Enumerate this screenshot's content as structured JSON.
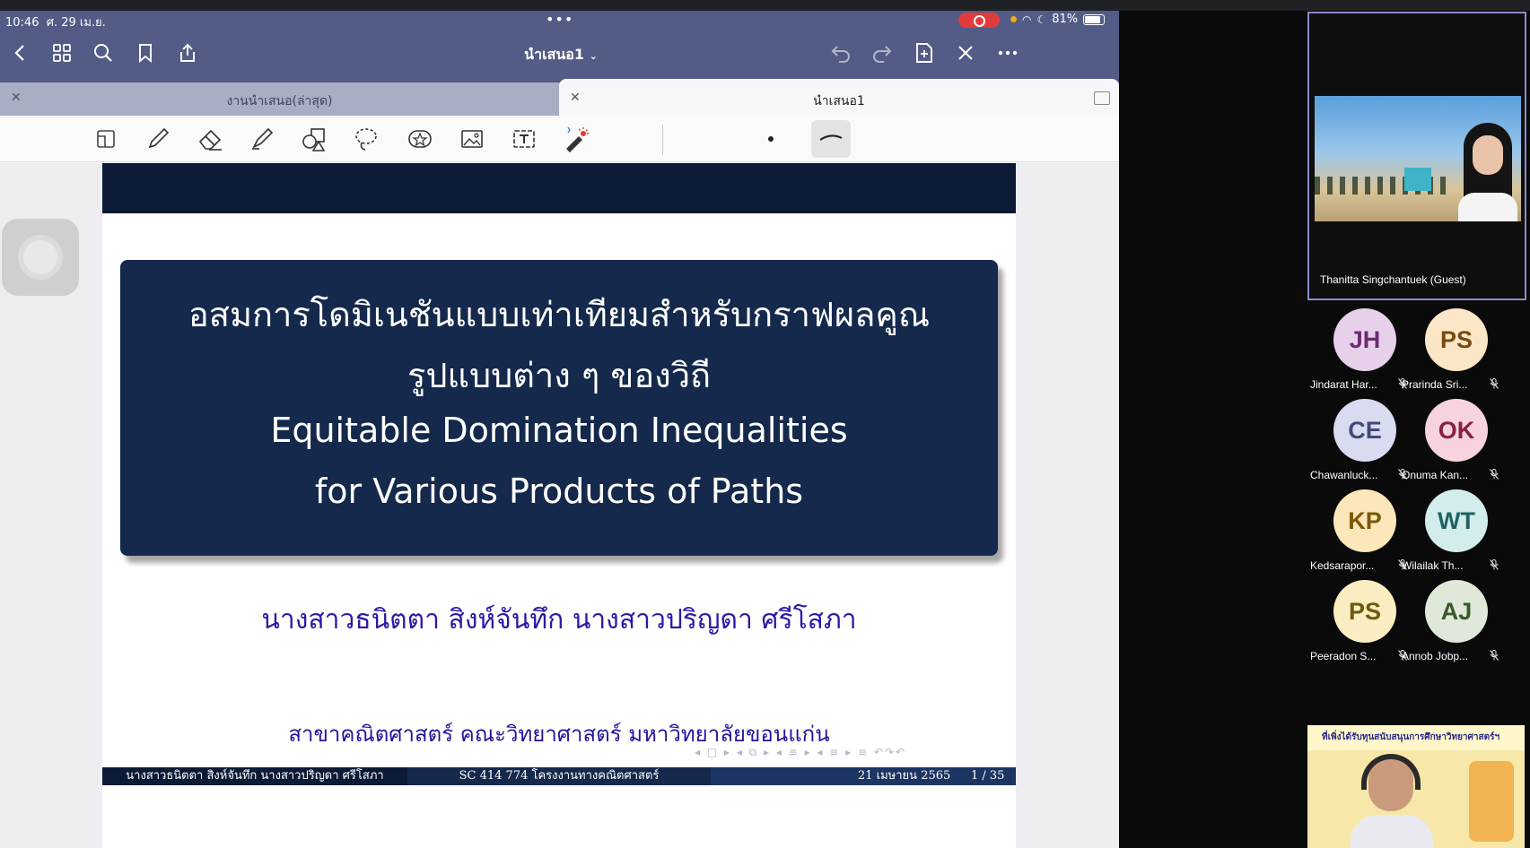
{
  "status": {
    "time": "10:46",
    "date": "ศ. 29 เม.ย.",
    "battery": "81%"
  },
  "nav": {
    "doc_title": "นำเสนอ1",
    "icons": [
      "chevron-left-icon",
      "grid-icon",
      "search-icon",
      "bookmark-icon",
      "share-icon",
      "undo-icon",
      "redo-icon",
      "add-page-icon",
      "close-icon",
      "more-icon"
    ]
  },
  "tabs": [
    {
      "label": "งานนำเสนอ(ล่าสุด)",
      "active": false
    },
    {
      "label": "นำเสนอ1",
      "active": true
    }
  ],
  "toolbar": {
    "tools": [
      "page-thumbnail-icon",
      "pen-icon",
      "eraser-icon",
      "highlighter-icon",
      "shapes-icon",
      "lasso-icon",
      "sticker-icon",
      "image-icon",
      "text-icon",
      "laser-pointer-icon"
    ]
  },
  "slide": {
    "title_th_1": "อสมการโดมิเนชันแบบเท่าเทียมสำหรับกราฟผลคูณ",
    "title_th_2": "รูปแบบต่าง ๆ ของวิถี",
    "title_en_1": "Equitable Domination Inequalities",
    "title_en_2": "for Various Products of Paths",
    "authors": "นางสาวธนิตตา สิงห์จันทึก นางสาวปริญดา ศรีโสภา",
    "department": "สาขาคณิตศาสตร์ คณะวิทยาศาสตร์ มหาวิทยาลัยขอนแก่น",
    "nav_symbols": "◂ □ ▸ ◂ ⧉ ▸ ◂ ≡ ▸ ◂ ≡ ▸   ≡   ↶↷↶",
    "footer_authors": "นางสาวธนิตตา สิงห์จันทึก นางสาวปริญดา ศรีโสภา",
    "footer_course": "SC 414 774 โครงงานทางคณิตศาสตร์",
    "footer_date": "21 เมษายน 2565",
    "footer_page": "1 / 35"
  },
  "teams": {
    "active_speaker_name": "Thanitta Singchantuek (Guest)",
    "participants": [
      {
        "initials": "JH",
        "name": "Jindarat Har...",
        "bg": "#e7d0ea",
        "fg": "#6a2b70"
      },
      {
        "initials": "PS",
        "name": "Prarinda Sri...",
        "bg": "#fbe6c7",
        "fg": "#7a4a10"
      },
      {
        "initials": "CE",
        "name": "Chawanluck...",
        "bg": "#d9dcf0",
        "fg": "#414a78"
      },
      {
        "initials": "OK",
        "name": "Onuma Kan...",
        "bg": "#f6d3dd",
        "fg": "#8a1f3f"
      },
      {
        "initials": "KP",
        "name": "Kedsarapor...",
        "bg": "#fbe7b9",
        "fg": "#7a5a08"
      },
      {
        "initials": "WT",
        "name": "Wilailak Th...",
        "bg": "#d3ecec",
        "fg": "#1f6464"
      },
      {
        "initials": "PS",
        "name": "Peeradon S...",
        "bg": "#faedc1",
        "fg": "#6d5a0e"
      },
      {
        "initials": "AJ",
        "name": "Annob Jobp...",
        "bg": "#dfe8d9",
        "fg": "#3b5a2b"
      }
    ],
    "bottom_video_banner": "ที่เพิ่งได้รับทุนสนับสนุนการศึกษาวิทยาศาสตร์ฯ"
  }
}
